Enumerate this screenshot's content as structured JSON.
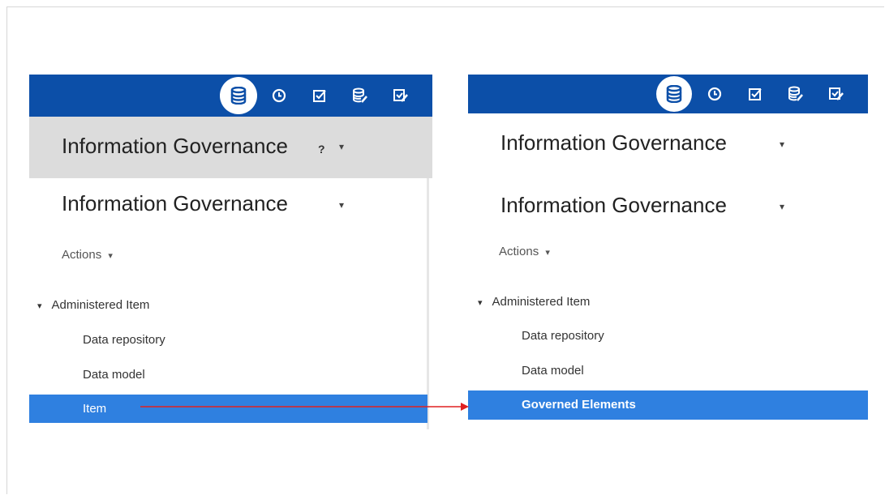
{
  "left": {
    "header_title": "Information Governance",
    "header_help": "?",
    "panel_title": "Information Governance",
    "actions_label": "Actions",
    "tree_root": "Administered Item",
    "children": [
      "Data repository",
      "Data model"
    ],
    "selected": "Item"
  },
  "right": {
    "header_title": "Information Governance",
    "panel_title": "Information Governance",
    "actions_label": "Actions",
    "tree_root": "Administered Item",
    "children": [
      "Data repository",
      "Data model"
    ],
    "selected": "Governed Elements"
  },
  "toolbar_icons": [
    "database-icon",
    "clock-icon",
    "checkbox-icon",
    "database-edit-icon",
    "checklist-edit-icon"
  ],
  "colors": {
    "topbar": "#0c4fa8",
    "selected_row": "#2f80e0",
    "header_gray": "#dcdcdc",
    "arrow": "#e02020"
  }
}
